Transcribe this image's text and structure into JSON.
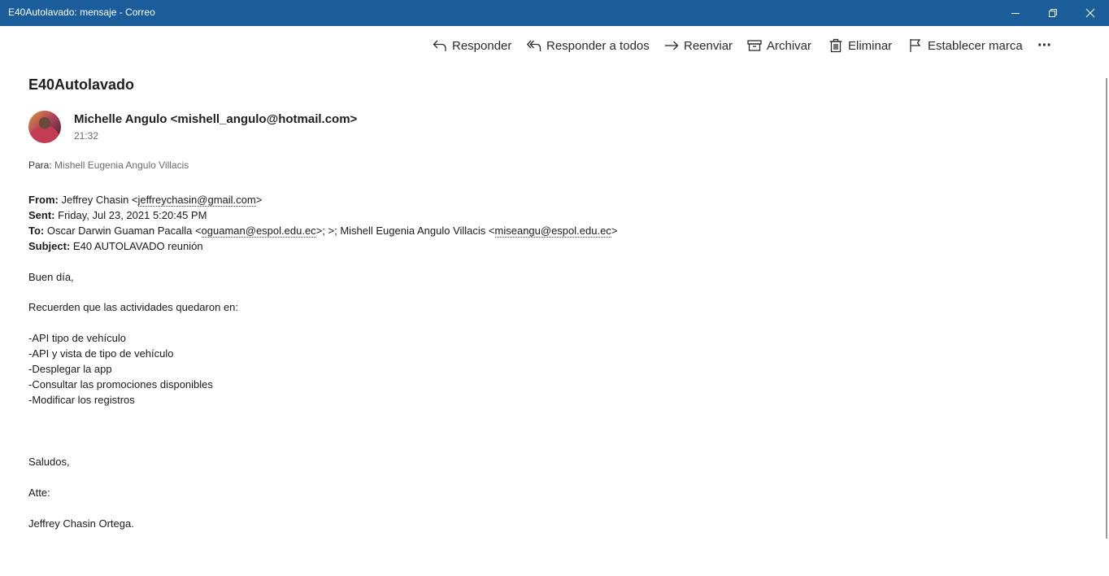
{
  "window": {
    "title": "E40Autolavado: mensaje - Correo"
  },
  "toolbar": {
    "reply": "Responder",
    "reply_all": "Responder a todos",
    "forward": "Reenviar",
    "archive": "Archivar",
    "delete": "Eliminar",
    "flag": "Establecer marca",
    "more": "···"
  },
  "message": {
    "subject": "E40Autolavado",
    "sender": "Michelle Angulo <mishell_angulo@hotmail.com>",
    "time": "21:32",
    "to_label": "Para:",
    "to_name": "Mishell Eugenia Angulo Villacis"
  },
  "forwarded": {
    "from_label": "From:",
    "from_name": "Jeffrey Chasin <",
    "from_email": "jeffreychasin@gmail.com",
    "from_end": ">",
    "sent_label": "Sent:",
    "sent_value": "Friday, Jul 23, 2021 5:20:45 PM",
    "to_label": "To:",
    "to_part1": "Oscar Darwin Guaman Pacalla <",
    "to_email1": "oguaman@espol.edu.ec",
    "to_part2": ">; >; Mishell Eugenia Angulo Villacis <",
    "to_email2": "miseangu@espol.edu.ec",
    "to_part3": ">",
    "subject_label": "Subject:",
    "subject_value": "E40 AUTOLAVADO reunión"
  },
  "body": {
    "greeting": "Buen día,",
    "intro": "Recuerden que las actividades quedaron en:",
    "items": [
      "-API tipo de vehículo",
      "-API y vista de tipo de vehículo",
      "-Desplegar la app",
      "-Consultar las promociones disponibles",
      "-Modificar los registros"
    ],
    "closing": "Saludos,",
    "atte": "Atte:",
    "signature": "Jeffrey Chasin Ortega."
  }
}
